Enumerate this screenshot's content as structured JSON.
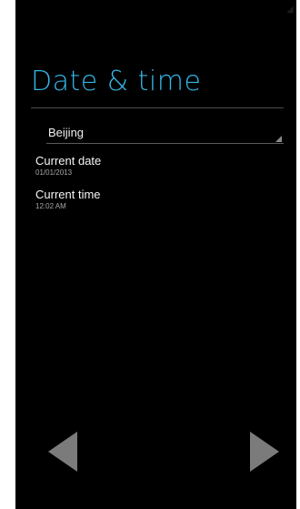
{
  "screen": {
    "title": "Date & time",
    "timezone": {
      "value": "Beijing"
    },
    "preferences": [
      {
        "title": "Current date",
        "summary": "01/01/2013"
      },
      {
        "title": "Current time",
        "summary": "12:02 AM"
      }
    ]
  },
  "colors": {
    "accent": "#33b5e5",
    "background": "#000000",
    "nav_arrow": "#7b7b7b"
  },
  "icons": {
    "nav_back": "triangle-left-icon",
    "nav_next": "triangle-right-icon",
    "dropdown": "dropdown-corner-icon"
  }
}
